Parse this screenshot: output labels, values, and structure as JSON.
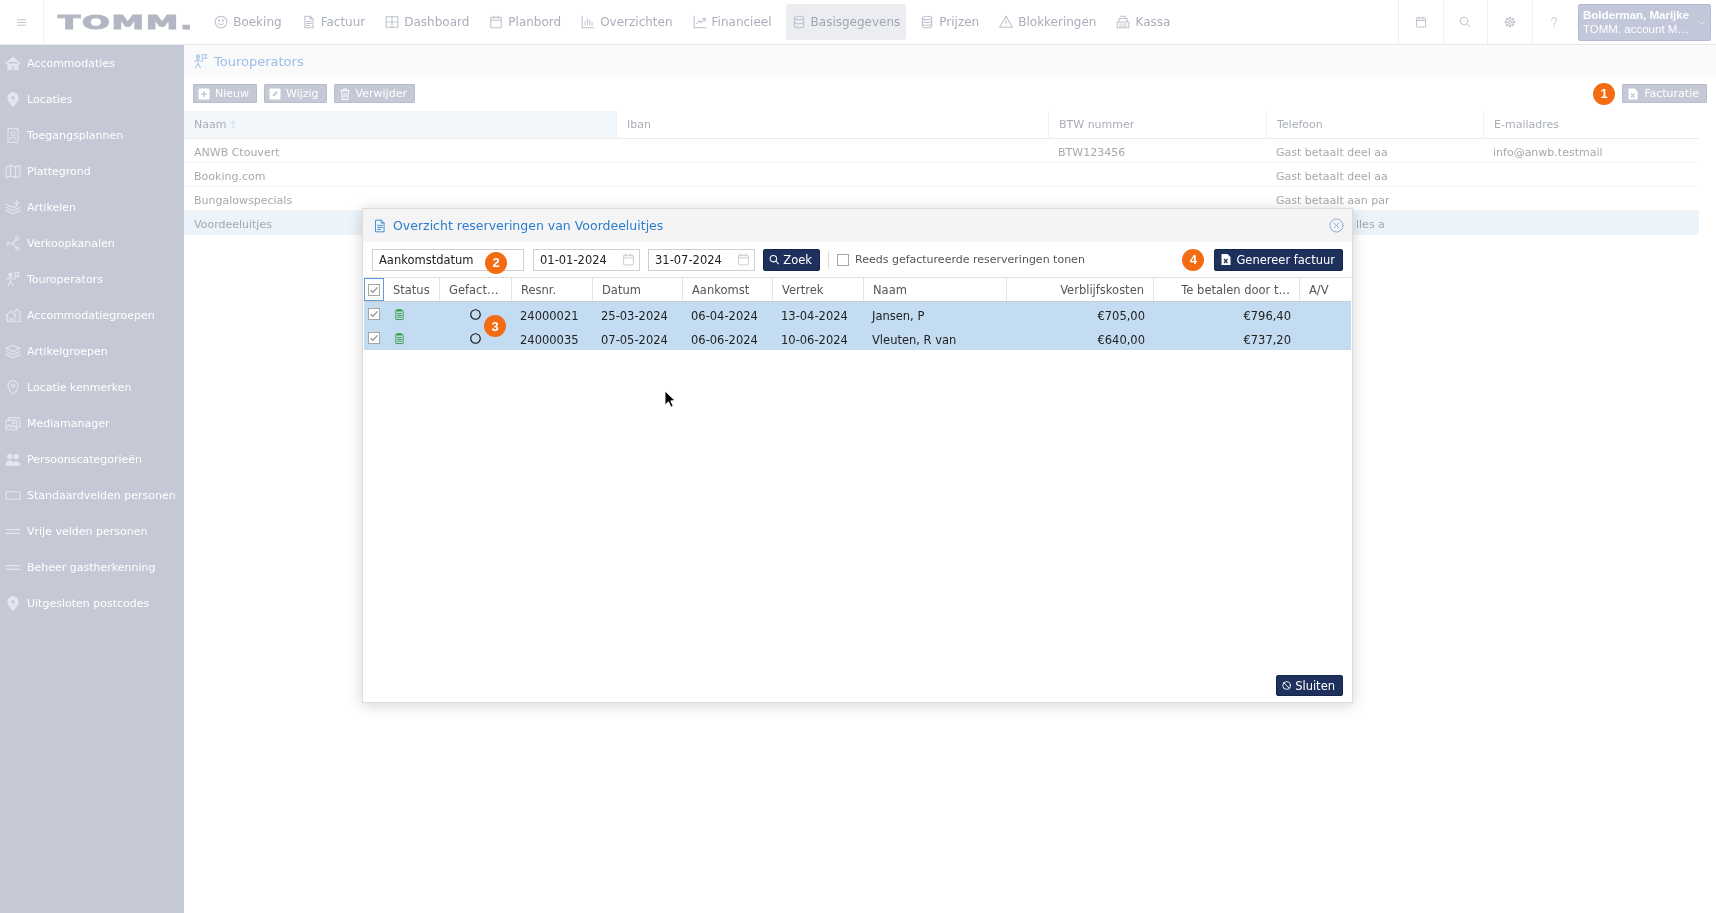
{
  "topbar": {
    "logo": "TOMM.",
    "nav": [
      {
        "label": "Boeking",
        "selected": false
      },
      {
        "label": "Factuur",
        "selected": false
      },
      {
        "label": "Dashboard",
        "selected": false
      },
      {
        "label": "Planbord",
        "selected": false
      },
      {
        "label": "Overzichten",
        "selected": false
      },
      {
        "label": "Financieel",
        "selected": false
      },
      {
        "label": "Basisgegevens",
        "selected": true
      },
      {
        "label": "Prijzen",
        "selected": false
      },
      {
        "label": "Blokkeringen",
        "selected": false
      },
      {
        "label": "Kassa",
        "selected": false
      }
    ],
    "user": {
      "name": "Bolderman, Marijke",
      "account": "TOMM. account M…"
    }
  },
  "sidebar": {
    "items": [
      {
        "label": "Accommodaties"
      },
      {
        "label": "Locaties"
      },
      {
        "label": "Toegangsplannen"
      },
      {
        "label": "Plattegrond"
      },
      {
        "label": "Artikelen"
      },
      {
        "label": "Verkoopkanalen"
      },
      {
        "label": "Touroperators"
      },
      {
        "label": "Accommodatiegroepen"
      },
      {
        "label": "Artikelgroepen"
      },
      {
        "label": "Locatie kenmerken"
      },
      {
        "label": "Mediamanager"
      },
      {
        "label": "Persoonscategorieën"
      },
      {
        "label": "Standaardvelden personen"
      },
      {
        "label": "Vrije velden personen"
      },
      {
        "label": "Beheer gastherkenning"
      },
      {
        "label": "Uitgesloten postcodes"
      }
    ]
  },
  "page": {
    "title": "Touroperators",
    "toolbar": {
      "buttons": [
        {
          "label": "Nieuw"
        },
        {
          "label": "Wijzig"
        },
        {
          "label": "Verwijder"
        }
      ],
      "invoice_button": {
        "label": "Facturatie",
        "marker": "1"
      }
    }
  },
  "table": {
    "columns": [
      {
        "label": "Naam",
        "sorted": true
      },
      {
        "label": "Iban",
        "sorted": false
      },
      {
        "label": "BTW nummer",
        "sorted": false
      },
      {
        "label": "Telefoon",
        "sorted": false
      },
      {
        "label": "E-mailadres",
        "sorted": false
      }
    ],
    "rows": [
      {
        "naam": "ANWB Ctouvert",
        "btw_nummer": "BTW123456",
        "telefoon": "Gast betaalt deel aa",
        "e_mailadres": "info@anwb.testmail",
        "selected": false
      },
      {
        "naam": "Booking.com",
        "telefoon": "Gast betaalt deel aa",
        "selected": false
      },
      {
        "naam": "Bungalowspecials",
        "telefoon": "Gast betaalt aan par",
        "selected": false
      },
      {
        "naam": "Voordeeluitjes",
        "telefoon": "lles a",
        "selected": true
      }
    ]
  },
  "dialog": {
    "title": "Overzicht reserveringen van Voordeeluitjes",
    "filter": {
      "date_type": {
        "value": "Aankomstdatum",
        "marker": "2"
      },
      "from": "01-01-2024",
      "to": "31-07-2024",
      "search_button": "Zoek",
      "show_invoiced": {
        "label": "Reeds gefactureerde reserveringen tonen",
        "checked": false
      },
      "generate_button": {
        "label": "Genereer factuur",
        "marker": "4"
      }
    },
    "table": {
      "marker": "3",
      "select_all": true,
      "columns": [
        "Status",
        "Gefact…",
        "Resnr.",
        "Datum",
        "Aankomst",
        "Vertrek",
        "Naam",
        "Verblijfskosten",
        "Te betalen door t…",
        "A/V"
      ],
      "rows": [
        {
          "checked": true,
          "selected": true,
          "invoiced": false,
          "resnr": "24000021",
          "datum": "25-03-2024",
          "aankomst": "06-04-2024",
          "vertrek": "13-04-2024",
          "naam": "Jansen, P",
          "verblijfskosten": "€705,00",
          "te_betalen": "€796,40"
        },
        {
          "checked": true,
          "selected": true,
          "invoiced": false,
          "resnr": "24000035",
          "datum": "07-05-2024",
          "aankomst": "06-06-2024",
          "vertrek": "10-06-2024",
          "naam": "Vleuten, R van",
          "verblijfskosten": "€640,00",
          "te_betalen": "€737,20"
        }
      ]
    },
    "close_button": "Sluiten"
  }
}
